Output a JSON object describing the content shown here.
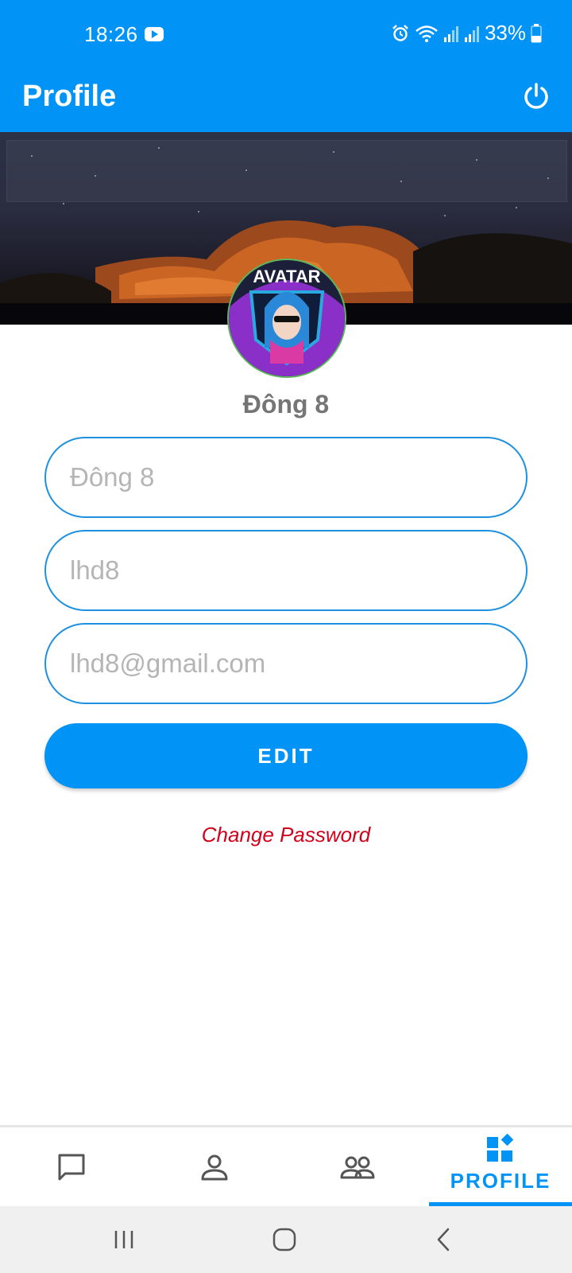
{
  "status_bar": {
    "time": "18:26",
    "battery": "33%",
    "icons": [
      "youtube-icon",
      "alarm-icon",
      "wifi-icon",
      "signal-icon",
      "signal-icon",
      "battery-icon"
    ]
  },
  "app_bar": {
    "title": "Profile",
    "action_icon": "power-icon"
  },
  "profile": {
    "display_name": "Đông 8",
    "avatar_text": "AVATAR"
  },
  "form": {
    "full_name": {
      "value": "",
      "placeholder": "Đông 8"
    },
    "username": {
      "value": "",
      "placeholder": "lhd8"
    },
    "email": {
      "value": "",
      "placeholder": "lhd8@gmail.com"
    },
    "edit_label": "EDIT",
    "change_password_label": "Change Password"
  },
  "bottom_nav": {
    "items": [
      {
        "icon": "chat-icon",
        "label": ""
      },
      {
        "icon": "person-icon",
        "label": ""
      },
      {
        "icon": "group-icon",
        "label": ""
      },
      {
        "icon": "dashboard-icon",
        "label": "PROFILE",
        "active": true
      }
    ]
  },
  "colors": {
    "primary": "#0193f6",
    "field_border": "#1e90e0",
    "placeholder_text": "#b5b5b5",
    "name_text": "#757575",
    "change_password": "#d0021b"
  }
}
